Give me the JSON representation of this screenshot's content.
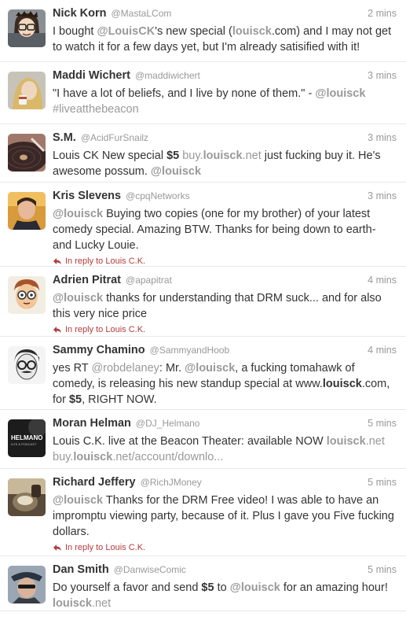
{
  "timeline": {
    "tweets": [
      {
        "fullname": "Nick Korn",
        "username": "@MastaLCom",
        "time": "2 mins",
        "text": [
          {
            "t": "I bought ",
            "s": ""
          },
          {
            "t": "@LouisCK",
            "s": "mb"
          },
          {
            "t": "'s new special (",
            "s": ""
          },
          {
            "t": "louisck",
            "s": "mb"
          },
          {
            "t": ".com) and I may not get to watch it for a few days yet, but I'm already satisified with it!",
            "s": ""
          }
        ],
        "avatar_icon": "cartoon-avatar-icon"
      },
      {
        "fullname": "Maddi Wichert",
        "username": "@maddiwichert",
        "time": "3 mins",
        "text": [
          {
            "t": "\"I have a lot of beliefs, and I live by none of them.\" - ",
            "s": ""
          },
          {
            "t": "@louisck",
            "s": "mb"
          },
          {
            "t": " ",
            "s": ""
          },
          {
            "t": "#liveatthebeacon",
            "s": "m"
          }
        ],
        "avatar_icon": "photo-avatar-icon"
      },
      {
        "fullname": "S.M.",
        "username": "@AcidFurSnailz",
        "time": "3 mins",
        "text": [
          {
            "t": "Louis CK New special ",
            "s": ""
          },
          {
            "t": "$5",
            "s": "b"
          },
          {
            "t": " buy.",
            "s": "m"
          },
          {
            "t": "louisck",
            "s": "mb"
          },
          {
            "t": ".net",
            "s": "m"
          },
          {
            "t": " just fucking buy it. He's awesome possum. ",
            "s": ""
          },
          {
            "t": "@louisck",
            "s": "mb"
          }
        ],
        "avatar_icon": "record-avatar-icon"
      },
      {
        "fullname": "Kris Slevens",
        "username": "@cpqNetworks",
        "time": "3 mins",
        "text": [
          {
            "t": "@louisck",
            "s": "mb"
          },
          {
            "t": " Buying two copies (one for my brother) of your latest comedy special. Amazing BTW. Thanks for being down to earth- and Lucky Louie.",
            "s": ""
          }
        ],
        "reply": "In reply to Louis C.K.",
        "avatar_icon": "photo-avatar-icon"
      },
      {
        "fullname": "Adrien Pitrat",
        "username": "@apapitrat",
        "time": "4 mins",
        "text": [
          {
            "t": "@louisck",
            "s": "mb"
          },
          {
            "t": " thanks for understanding that DRM suck... and for also this very nice price",
            "s": ""
          }
        ],
        "reply": "In reply to Louis C.K.",
        "avatar_icon": "cartoon-avatar-icon"
      },
      {
        "fullname": "Sammy Chamino",
        "username": "@SammyandHoob",
        "time": "4 mins",
        "text": [
          {
            "t": "yes RT ",
            "s": ""
          },
          {
            "t": "@robdelaney",
            "s": "m"
          },
          {
            "t": ": Mr. ",
            "s": ""
          },
          {
            "t": "@louisck",
            "s": "mb"
          },
          {
            "t": ", a fucking tomahawk of comedy, is releasing his new standup special at www.",
            "s": ""
          },
          {
            "t": "louisck",
            "s": "b"
          },
          {
            "t": ".com, for ",
            "s": ""
          },
          {
            "t": "$5",
            "s": "b"
          },
          {
            "t": ", RIGHT NOW.",
            "s": ""
          }
        ],
        "avatar_icon": "sketch-avatar-icon"
      },
      {
        "fullname": "Moran Helman",
        "username": "@DJ_Helmano",
        "time": "5 mins",
        "text": [
          {
            "t": "Louis C.K. live at the Beacon Theater: available NOW ",
            "s": ""
          },
          {
            "t": "louisck",
            "s": "mb"
          },
          {
            "t": ".net",
            "s": "m"
          },
          {
            "t": " buy.",
            "s": "m"
          },
          {
            "t": "louisck",
            "s": "mb"
          },
          {
            "t": ".net/account/downlo...",
            "s": "m"
          }
        ],
        "avatar_icon": "logo-avatar-icon",
        "avatar_text": "HELMANO",
        "avatar_subtext": "DJ'S & PODCAST"
      },
      {
        "fullname": "Richard Jeffery",
        "username": "@RichJMoney",
        "time": "5 mins",
        "text": [
          {
            "t": "@louisck",
            "s": "mb"
          },
          {
            "t": " Thanks for the DRM Free video! I was able to have an impromptu viewing party, because of it. Plus I gave you Five fucking dollars.",
            "s": ""
          }
        ],
        "reply": "In reply to Louis C.K.",
        "avatar_icon": "photo-avatar-icon"
      },
      {
        "fullname": "Dan Smith",
        "username": "@DanwiseComic",
        "time": "5 mins",
        "text": [
          {
            "t": "Do yourself a favor and send ",
            "s": ""
          },
          {
            "t": "$5",
            "s": "b"
          },
          {
            "t": " to ",
            "s": ""
          },
          {
            "t": "@louisck",
            "s": "mb"
          },
          {
            "t": " for an amazing hour! ",
            "s": ""
          },
          {
            "t": "louisck",
            "s": "mb"
          },
          {
            "t": ".net",
            "s": "m"
          }
        ],
        "avatar_icon": "photo-avatar-icon"
      }
    ]
  },
  "colors": {
    "text": "#333333",
    "muted": "#999999",
    "reply": "#b33b3b",
    "divider": "#e8e8e8"
  }
}
